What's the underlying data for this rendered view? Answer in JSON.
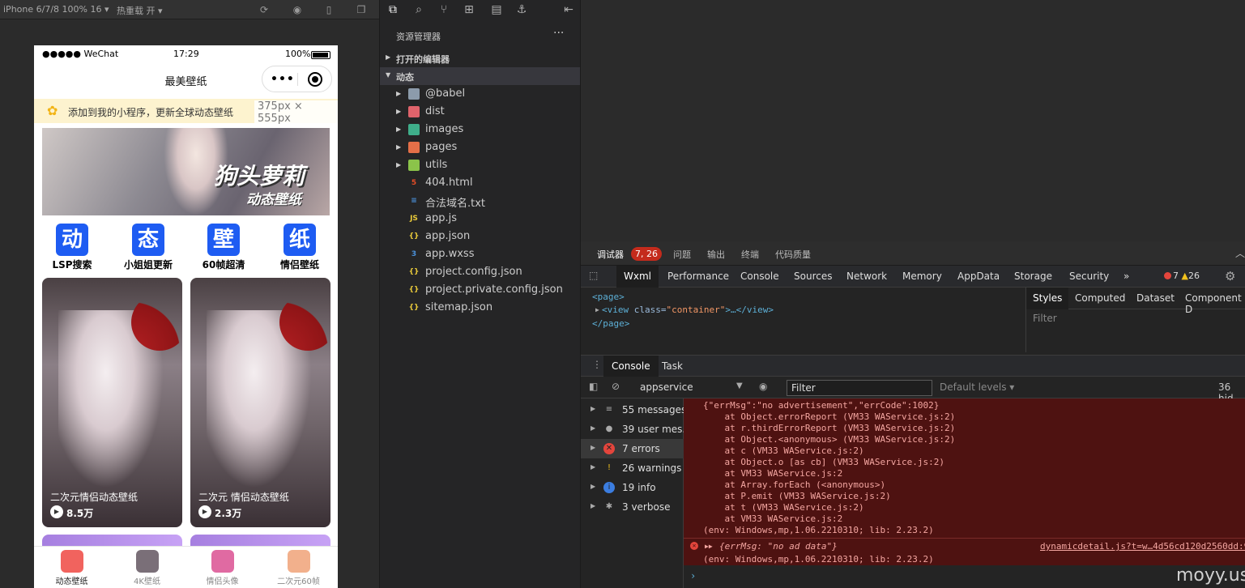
{
  "simulator": {
    "device": "iPhone 6/7/8 100% 16 ▾",
    "hot_reload": "热重载 开 ▾",
    "statusbar": {
      "carrier": "●●●●● WeChat",
      "time": "17:29",
      "battery": "100%"
    },
    "navbar_title": "最美壁纸",
    "capsule_menu": "•••",
    "notice": "添加到我的小程序，更新全球动态壁纸",
    "size_badge": "375px × 555px",
    "banner": {
      "title": "狗头萝莉",
      "subtitle": "动态壁纸"
    },
    "categories": [
      {
        "glyph": "动",
        "label": "LSP搜索"
      },
      {
        "glyph": "态",
        "label": "小姐姐更新"
      },
      {
        "glyph": "壁",
        "label": "60帧超清"
      },
      {
        "glyph": "纸",
        "label": "情侣壁纸"
      }
    ],
    "cards": [
      {
        "title": "二次元情侣动态壁纸",
        "views": "8.5万"
      },
      {
        "title": "二次元 情侣动态壁纸",
        "views": "2.3万"
      }
    ],
    "tabbar": [
      {
        "label": "动态壁纸",
        "color": "#f1635e"
      },
      {
        "label": "4K壁纸",
        "color": "#7a6f78"
      },
      {
        "label": "情侣头像",
        "color": "#e06aa2"
      },
      {
        "label": "二次元60帧",
        "color": "#f2b08c"
      }
    ]
  },
  "explorer": {
    "title": "资源管理器",
    "more": "···",
    "sections": {
      "open_editors": "打开的编辑器",
      "project": "动态"
    },
    "items": [
      {
        "name": "@babel",
        "type": "folder",
        "color": "#8c9bab",
        "glyph": ""
      },
      {
        "name": "dist",
        "type": "folder",
        "color": "#e0636b",
        "glyph": ""
      },
      {
        "name": "images",
        "type": "folder",
        "color": "#3fae8a",
        "glyph": ""
      },
      {
        "name": "pages",
        "type": "folder",
        "color": "#e46f48",
        "glyph": ""
      },
      {
        "name": "utils",
        "type": "folder",
        "color": "#8bc34a",
        "glyph": ""
      },
      {
        "name": "404.html",
        "type": "file",
        "color": "#e44d26",
        "glyph": "5"
      },
      {
        "name": "合法域名.txt",
        "type": "file",
        "color": "#4a90d9",
        "glyph": "≡"
      },
      {
        "name": "app.js",
        "type": "file",
        "color": "#e8c93a",
        "glyph": "JS"
      },
      {
        "name": "app.json",
        "type": "file",
        "color": "#e8c93a",
        "glyph": "{}"
      },
      {
        "name": "app.wxss",
        "type": "file",
        "color": "#4a90d9",
        "glyph": "3"
      },
      {
        "name": "project.config.json",
        "type": "file",
        "color": "#e8c93a",
        "glyph": "{}"
      },
      {
        "name": "project.private.config.json",
        "type": "file",
        "color": "#e8c93a",
        "glyph": "{}"
      },
      {
        "name": "sitemap.json",
        "type": "file",
        "color": "#e8c93a",
        "glyph": "{}"
      }
    ]
  },
  "debugger": {
    "top_tabs": [
      "调试器",
      "问题",
      "输出",
      "终端",
      "代码质量"
    ],
    "badge": "7, 26",
    "devtools_tabs": [
      "Wxml",
      "Performance",
      "Console",
      "Sources",
      "Network",
      "Memory",
      "AppData",
      "Storage",
      "Security"
    ],
    "more_tabs": "»",
    "error_count": "7",
    "warning_count": "26",
    "wxml": {
      "line1": "<page>",
      "line2_tag": "<view",
      "line2_attr": " class=",
      "line2_val": "\"container\"",
      "line2_end": ">…</view>",
      "line3": "</page>"
    },
    "styles_tabs": [
      "Styles",
      "Computed",
      "Dataset",
      "Component D"
    ],
    "styles_filter": "Filter",
    "console_tabs": [
      "Console",
      "Task"
    ],
    "context": "appservice",
    "filter_placeholder": "Filter",
    "levels": "Default levels ▾",
    "hidden": "36 hid",
    "sidebar": [
      {
        "label": "55 messages",
        "icon": "≡",
        "color": "#aaaaaa"
      },
      {
        "label": "39 user mes...",
        "icon": "●",
        "color": "#aaaaaa"
      },
      {
        "label": "7 errors",
        "icon": "✕",
        "color": "#e4453c"
      },
      {
        "label": "26 warnings",
        "icon": "!",
        "color": "#f2c21c"
      },
      {
        "label": "19 info",
        "icon": "i",
        "color": "#3b7de0"
      },
      {
        "label": "3 verbose",
        "icon": "✱",
        "color": "#aaaaaa"
      }
    ],
    "error_lines": [
      "{\"errMsg\":\"no advertisement\",\"errCode\":1002}",
      "    at Object.errorReport (VM33 WAService.js:2)",
      "    at r.thirdErrorReport (VM33 WAService.js:2)",
      "    at Object.<anonymous> (VM33 WAService.js:2)",
      "    at c (VM33 WAService.js:2)",
      "    at Object.o [as cb] (VM33 WAService.js:2)",
      "    at VM33 WAService.js:2",
      "    at Array.forEach (<anonymous>)",
      "    at P.emit (VM33 WAService.js:2)",
      "    at t (VM33 WAService.js:2)",
      "    at VM33 WAService.js:2",
      "(env: Windows,mp,1.06.2210310; lib: 2.23.2)"
    ],
    "error2": {
      "message": "{errMsg: \"no ad data\"}",
      "source": "dynamicdetail.js?t=w…4d56cd120d2560dd:9",
      "env": "(env: Windows,mp,1.06.2210310; lib: 2.23.2)"
    },
    "prompt": "›"
  },
  "watermark": "moyy.us"
}
